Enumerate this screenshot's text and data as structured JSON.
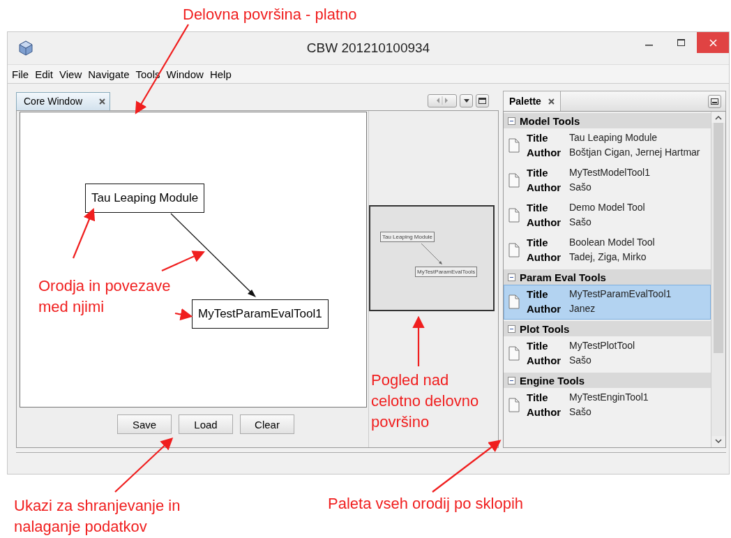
{
  "window": {
    "title": "CBW 201210100934"
  },
  "menu": [
    "File",
    "Edit",
    "View",
    "Navigate",
    "Tools",
    "Window",
    "Help"
  ],
  "editor": {
    "tab": {
      "label": "Core Window",
      "selected": true
    },
    "nodes": [
      {
        "label": "Tau Leaping Module"
      },
      {
        "label": "MyTestParamEvalTool1"
      }
    ],
    "overview_nodes": [
      {
        "label": "Tau Leaping Module"
      },
      {
        "label": "MyTestParamEvalTools"
      }
    ],
    "buttons": [
      "Save",
      "Load",
      "Clear"
    ]
  },
  "palette": {
    "tab": {
      "label": "Palette",
      "selected": true
    },
    "sections": [
      {
        "name": "Model Tools",
        "expanded": true,
        "items": [
          {
            "title_label": "Title",
            "title": "Tau Leaping Module",
            "author_label": "Author",
            "author": "Boštjan Cigan, Jernej Hartmar",
            "selected": false
          },
          {
            "title_label": "Title",
            "title": "MyTestModelTool1",
            "author_label": "Author",
            "author": "Sašo",
            "selected": false
          },
          {
            "title_label": "Title",
            "title": "Demo Model Tool",
            "author_label": "Author",
            "author": "Sašo",
            "selected": false
          },
          {
            "title_label": "Title",
            "title": "Boolean Model Tool",
            "author_label": "Author",
            "author": "Tadej, Ziga, Mirko",
            "selected": false
          }
        ]
      },
      {
        "name": "Param Eval Tools",
        "expanded": true,
        "items": [
          {
            "title_label": "Title",
            "title": "MyTestParamEvalTool1",
            "author_label": "Author",
            "author": "Janez",
            "selected": true
          }
        ]
      },
      {
        "name": "Plot Tools",
        "expanded": true,
        "items": [
          {
            "title_label": "Title",
            "title": "MyTestPlotTool",
            "author_label": "Author",
            "author": "Sašo",
            "selected": false
          }
        ]
      },
      {
        "name": "Engine Tools",
        "expanded": true,
        "items": [
          {
            "title_label": "Title",
            "title": "MyTestEnginTool1",
            "author_label": "Author",
            "author": "Sašo",
            "selected": false
          }
        ]
      }
    ]
  },
  "annotations": [
    {
      "text": "Delovna površina - platno"
    },
    {
      "text": "Orodja in povezave med njimi"
    },
    {
      "text": "Pogled nad celotno delovno površino"
    },
    {
      "text": "Ukazi za shranjevanje in nalaganje podatkov"
    },
    {
      "text": "Paleta vseh orodij po sklopih"
    }
  ]
}
